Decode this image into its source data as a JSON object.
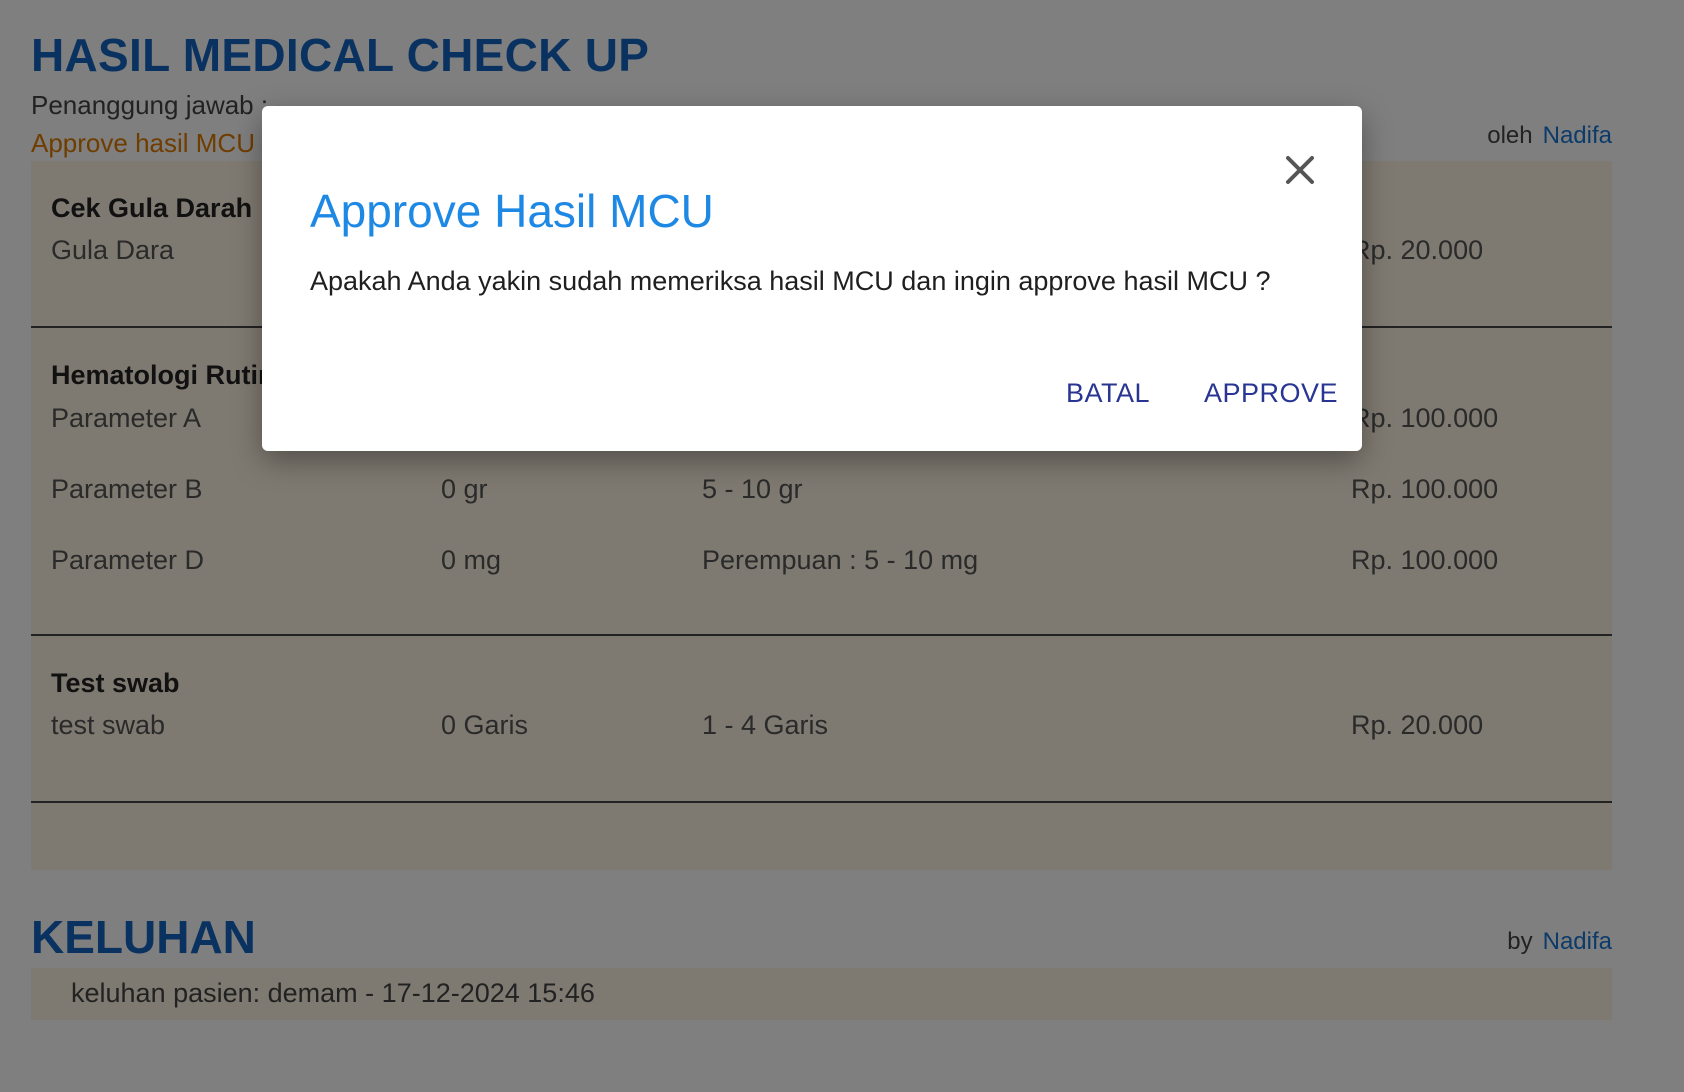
{
  "header": {
    "title": "HASIL MEDICAL CHECK UP",
    "responsible_label": "Penanggung jawab :",
    "responsible_value": "-",
    "approve_link": "Approve hasil MCU",
    "by_label": "oleh",
    "by_name": "Nadifa"
  },
  "sections": [
    {
      "title": "Cek Gula Darah",
      "rows": [
        {
          "name": "Gula Dara",
          "result": "",
          "range": "",
          "price": "Rp. 20.000"
        }
      ]
    },
    {
      "title": "Hematologi Rutin",
      "rows": [
        {
          "name": "Parameter A",
          "result": "",
          "range": "",
          "price": "Rp. 100.000"
        },
        {
          "name": "Parameter B",
          "result": "0 gr",
          "range": "5 - 10 gr",
          "price": "Rp. 100.000"
        },
        {
          "name": "Parameter D",
          "result": "0 mg",
          "range": "Perempuan : 5 - 10 mg",
          "price": "Rp. 100.000"
        }
      ]
    },
    {
      "title": "Test swab",
      "rows": [
        {
          "name": "test swab",
          "result": "0 Garis",
          "range": "1 - 4 Garis",
          "price": "Rp. 20.000"
        }
      ]
    }
  ],
  "keluhan": {
    "title": "KELUHAN",
    "by_label": "by",
    "by_name": "Nadifa",
    "text": "keluhan pasien: demam - 17-12-2024 15:46"
  },
  "dialog": {
    "title": "Approve Hasil MCU",
    "message": "Apakah Anda yakin sudah memeriksa hasil MCU dan ingin approve hasil MCU ?",
    "cancel_label": "BATAL",
    "approve_label": "APPROVE",
    "close_icon": "close-icon"
  },
  "colors": {
    "primary": "#1565c0",
    "accent_orange": "#e07b00",
    "panel_bg": "#fff4e2",
    "dialog_title": "#1e88e5",
    "button_text": "#283593"
  }
}
